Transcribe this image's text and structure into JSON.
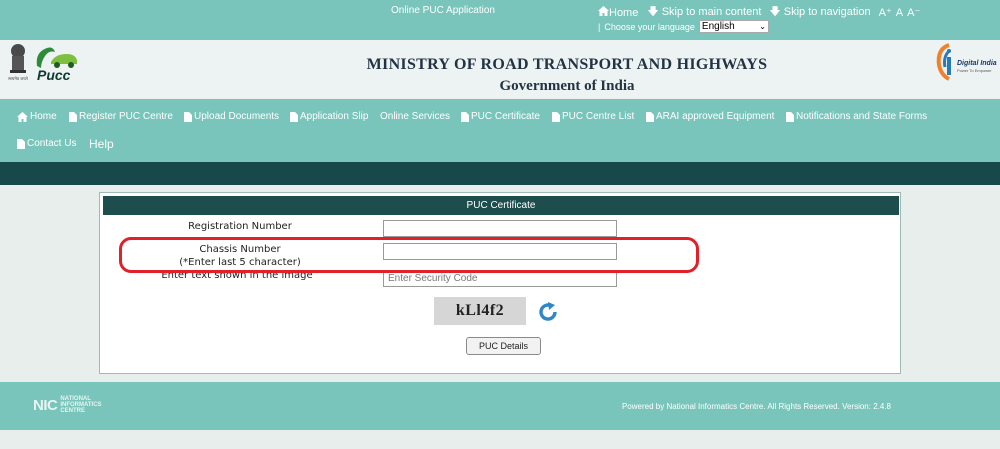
{
  "topbar": {
    "title": "Online PUC Application",
    "home": "Home",
    "skip_main": "Skip to main content",
    "skip_nav": "Skip to navigation",
    "font_large": "A⁺",
    "font_normal": "A",
    "font_small": "A⁻",
    "lang_prefix": "|",
    "lang_label": "Choose your language",
    "lang_value": "English"
  },
  "header": {
    "ministry": "MINISTRY OF ROAD TRANSPORT AND HIGHWAYS",
    "govt": "Government of India",
    "logo_text": "Pucc",
    "emblem_caption": "सत्यमेव जयते",
    "digital_title": "Digital India",
    "digital_tagline": "Power To Empower"
  },
  "nav": [
    {
      "label": "Home",
      "icon": "home-icon"
    },
    {
      "label": "Register PUC Centre",
      "icon": "file-icon"
    },
    {
      "label": "Upload Documents",
      "icon": "file-icon"
    },
    {
      "label": "Application Slip",
      "icon": "file-icon"
    },
    {
      "label": "Online Services",
      "icon": ""
    },
    {
      "label": "PUC Certificate",
      "icon": "file-icon"
    },
    {
      "label": "PUC Centre List",
      "icon": "file-icon"
    },
    {
      "label": "ARAI approved Equipment",
      "icon": "file-icon"
    },
    {
      "label": "Notifications and State Forms",
      "icon": "file-icon"
    },
    {
      "label": "Contact Us",
      "icon": "file-icon"
    },
    {
      "label": "Help",
      "icon": ""
    }
  ],
  "form": {
    "heading": "PUC Certificate",
    "reg_label": "Registration Number",
    "reg_value": "",
    "chassis_label": "Chassis Number",
    "chassis_note": "(*Enter last 5 character)",
    "chassis_value": "",
    "captcha_label": "Enter text shown in the image",
    "captcha_placeholder": "Enter Security Code",
    "captcha_text": "kLl4f2",
    "submit_label": "PUC Details"
  },
  "footer": {
    "nic_abbr": "NIC",
    "nic_line1": "NATIONAL",
    "nic_line2": "INFORMATICS",
    "nic_line3": "CENTRE",
    "powered": "Powered by National Informatics Centre. All Rights Reserved. Version: 2.4.8"
  },
  "colors": {
    "teal": "#79c5bb",
    "dark_teal": "#17494a",
    "panel_header": "#1d4d4d",
    "highlight": "#e0212a"
  }
}
